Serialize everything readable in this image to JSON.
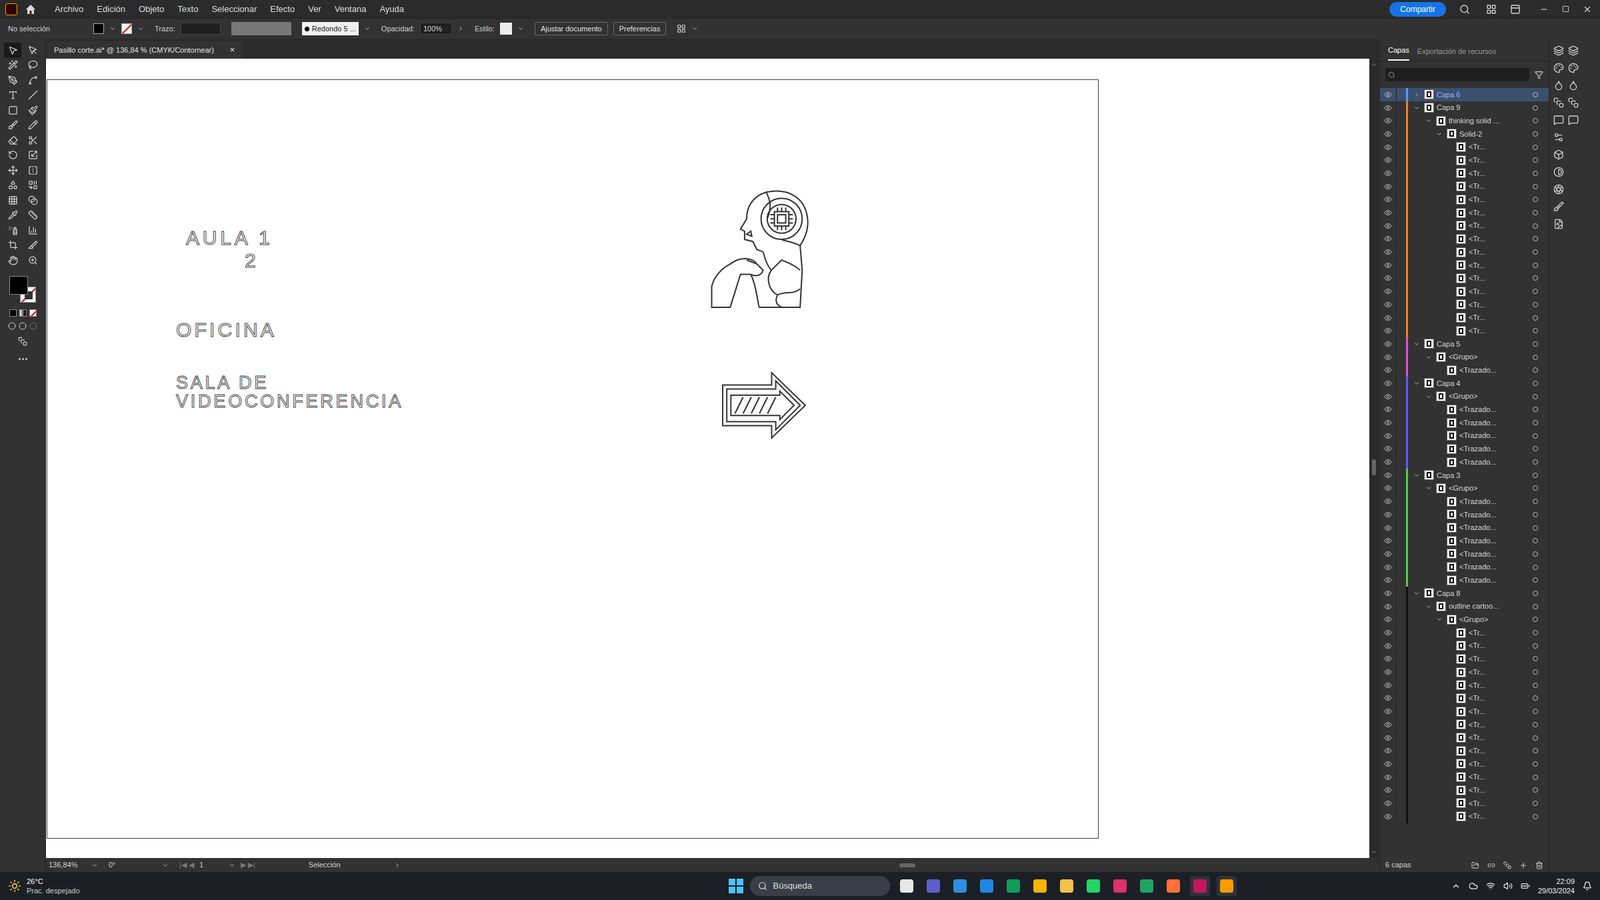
{
  "menu": [
    "Archivo",
    "Edición",
    "Objeto",
    "Texto",
    "Seleccionar",
    "Efecto",
    "Ver",
    "Ventana",
    "Ayuda"
  ],
  "share_button": "Compartir",
  "control_bar": {
    "selection": "No selección",
    "stroke_label": "Trazo:",
    "brush": "Redondo 5 ...",
    "opacity_label": "Opacidad:",
    "opacity": "100%",
    "style_label": "Estilo:",
    "buttons": [
      "Ajustar documento",
      "Preferencias"
    ]
  },
  "document_tab": {
    "title": "Pasillo corte.ai* @ 136,84 % (CMYK/Contornear)",
    "close": "×"
  },
  "canvas": {
    "texts": [
      {
        "label": "AULA 1"
      },
      {
        "label": "2"
      },
      {
        "label": "OFICINA"
      },
      {
        "label": "SALA DE"
      },
      {
        "label": "VIDEOCONFERENCIA"
      }
    ]
  },
  "layers_panel": {
    "tabs": [
      {
        "label": "Capas",
        "selected": true
      },
      {
        "label": "Exportación de recursos",
        "selected": false
      }
    ],
    "rows": [
      {
        "label": "Capa 6",
        "depth": 0,
        "expanded": false,
        "selected": true,
        "color": "#4f9dff"
      },
      {
        "label": "Capa 9",
        "depth": 0,
        "expanded": true,
        "selected": false,
        "color": "#ff7b1a"
      },
      {
        "label": "thinking solid ...",
        "depth": 1,
        "expanded": true,
        "selected": false,
        "color": "#ff7b1a"
      },
      {
        "label": "Solid-2",
        "depth": 2,
        "expanded": true,
        "selected": false,
        "color": "#ff7b1a"
      },
      {
        "label": "<Tr...",
        "depth": 3,
        "selected": false,
        "color": "#ff7b1a"
      },
      {
        "label": "<Tr...",
        "depth": 3,
        "selected": false,
        "color": "#ff7b1a"
      },
      {
        "label": "<Tr...",
        "depth": 3,
        "selected": false,
        "color": "#ff7b1a"
      },
      {
        "label": "<Tr...",
        "depth": 3,
        "selected": false,
        "color": "#ff7b1a"
      },
      {
        "label": "<Tr...",
        "depth": 3,
        "selected": false,
        "color": "#ff7b1a"
      },
      {
        "label": "<Tr...",
        "depth": 3,
        "selected": false,
        "color": "#ff7b1a"
      },
      {
        "label": "<Tr...",
        "depth": 3,
        "selected": false,
        "color": "#ff7b1a"
      },
      {
        "label": "<Tr...",
        "depth": 3,
        "selected": false,
        "color": "#ff7b1a"
      },
      {
        "label": "<Tr...",
        "depth": 3,
        "selected": false,
        "color": "#ff7b1a"
      },
      {
        "label": "<Tr...",
        "depth": 3,
        "selected": false,
        "color": "#ff7b1a"
      },
      {
        "label": "<Tr...",
        "depth": 3,
        "selected": false,
        "color": "#ff7b1a"
      },
      {
        "label": "<Tr...",
        "depth": 3,
        "selected": false,
        "color": "#ff7b1a"
      },
      {
        "label": "<Tr...",
        "depth": 3,
        "selected": false,
        "color": "#ff7b1a"
      },
      {
        "label": "<Tr...",
        "depth": 3,
        "selected": false,
        "color": "#ff7b1a"
      },
      {
        "label": "<Tr...",
        "depth": 3,
        "selected": false,
        "color": "#ff7b1a"
      },
      {
        "label": "Capa 5",
        "depth": 0,
        "expanded": true,
        "selected": false,
        "color": "#e04fd6"
      },
      {
        "label": "<Grupo>",
        "depth": 1,
        "expanded": true,
        "selected": false,
        "color": "#e04fd6"
      },
      {
        "label": "<Trazado...",
        "depth": 2,
        "selected": false,
        "color": "#e04fd6"
      },
      {
        "label": "Capa 4",
        "depth": 0,
        "expanded": true,
        "selected": false,
        "color": "#5a5cff"
      },
      {
        "label": "<Grupo>",
        "depth": 1,
        "expanded": true,
        "selected": false,
        "color": "#5a5cff"
      },
      {
        "label": "<Trazado...",
        "depth": 2,
        "selected": false,
        "color": "#5a5cff"
      },
      {
        "label": "<Trazado...",
        "depth": 2,
        "selected": false,
        "color": "#5a5cff"
      },
      {
        "label": "<Trazado...",
        "depth": 2,
        "selected": false,
        "color": "#5a5cff"
      },
      {
        "label": "<Trazado...",
        "depth": 2,
        "selected": false,
        "color": "#5a5cff"
      },
      {
        "label": "<Trazado...",
        "depth": 2,
        "selected": false,
        "color": "#5a5cff"
      },
      {
        "label": "Capa 3",
        "depth": 0,
        "expanded": true,
        "selected": false,
        "color": "#4fd14f"
      },
      {
        "label": "<Grupo>",
        "depth": 1,
        "expanded": true,
        "selected": false,
        "color": "#4fd14f"
      },
      {
        "label": "<Trazado...",
        "depth": 2,
        "selected": false,
        "color": "#4fd14f"
      },
      {
        "label": "<Trazado...",
        "depth": 2,
        "selected": false,
        "color": "#4fd14f"
      },
      {
        "label": "<Trazado...",
        "depth": 2,
        "selected": false,
        "color": "#4fd14f"
      },
      {
        "label": "<Trazado...",
        "depth": 2,
        "selected": false,
        "color": "#4fd14f"
      },
      {
        "label": "<Trazado...",
        "depth": 2,
        "selected": false,
        "color": "#4fd14f"
      },
      {
        "label": "<Trazado...",
        "depth": 2,
        "selected": false,
        "color": "#4fd14f"
      },
      {
        "label": "<Trazado...",
        "depth": 2,
        "selected": false,
        "color": "#4fd14f"
      },
      {
        "label": "Capa 8",
        "depth": 0,
        "expanded": true,
        "selected": false,
        "color": "#111111"
      },
      {
        "label": "outline cartoo...",
        "depth": 1,
        "expanded": true,
        "selected": false,
        "color": "#111111"
      },
      {
        "label": "<Grupo>",
        "depth": 2,
        "expanded": true,
        "selected": false,
        "color": "#111111"
      },
      {
        "label": "<Tr...",
        "depth": 3,
        "selected": false,
        "color": "#111111"
      },
      {
        "label": "<Tr...",
        "depth": 3,
        "selected": false,
        "color": "#111111"
      },
      {
        "label": "<Tr...",
        "depth": 3,
        "selected": false,
        "color": "#111111"
      },
      {
        "label": "<Tr...",
        "depth": 3,
        "selected": false,
        "color": "#111111"
      },
      {
        "label": "<Tr...",
        "depth": 3,
        "selected": false,
        "color": "#111111"
      },
      {
        "label": "<Tr...",
        "depth": 3,
        "selected": false,
        "color": "#111111"
      },
      {
        "label": "<Tr...",
        "depth": 3,
        "selected": false,
        "color": "#111111"
      },
      {
        "label": "<Tr...",
        "depth": 3,
        "selected": false,
        "color": "#111111"
      },
      {
        "label": "<Tr...",
        "depth": 3,
        "selected": false,
        "color": "#111111"
      },
      {
        "label": "<Tr...",
        "depth": 3,
        "selected": false,
        "color": "#111111"
      },
      {
        "label": "<Tr...",
        "depth": 3,
        "selected": false,
        "color": "#111111"
      },
      {
        "label": "<Tr...",
        "depth": 3,
        "selected": false,
        "color": "#111111"
      },
      {
        "label": "<Tr...",
        "depth": 3,
        "selected": false,
        "color": "#111111"
      },
      {
        "label": "<Tr...",
        "depth": 3,
        "selected": false,
        "color": "#111111"
      },
      {
        "label": "<Tr...",
        "depth": 3,
        "selected": false,
        "color": "#111111"
      }
    ],
    "footer": "6 capas"
  },
  "status_bar": {
    "zoom": "136,84%",
    "rotation": "0°",
    "artboard": "1",
    "tool": "Selección"
  },
  "taskbar": {
    "temperature": "26°C",
    "weather": "Prac. despejado",
    "search": "Búsqueda",
    "time": "22:09",
    "date": "29/03/2024"
  }
}
